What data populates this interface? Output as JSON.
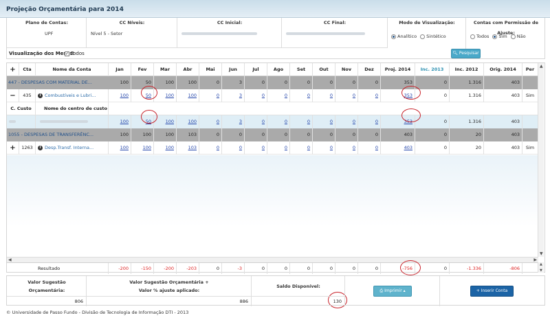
{
  "window": {
    "title": "Projeção Orçamentária para 2014"
  },
  "filters": {
    "plano_label": "Plano de Contas:",
    "plano_value": "UPF",
    "cc_niveis_label": "CC Níveis:",
    "cc_niveis_value": "Nível 5 - Setor",
    "cc_inicial_label": "CC Inicial:",
    "cc_final_label": "CC Final:",
    "modo_label": "Modo de Visualização:",
    "modo_opt1": "Analítico",
    "modo_opt2": "Sintético",
    "contas_label": "Contas com Permissão de Ajuste:",
    "contas_opt1": "Todos",
    "contas_opt2": "Sim",
    "contas_opt3": "Não",
    "meses_label": "Visualização dos Meses:",
    "meses_check": "✓",
    "meses_opt": "Todos",
    "pesquisar_label": "Pesquisar"
  },
  "table": {
    "headers": {
      "plus": "+",
      "cta": "Cta",
      "nome": "Nome da Conta",
      "jan": "Jan",
      "fev": "Fev",
      "mar": "Mar",
      "abr": "Abr",
      "mai": "Mai",
      "jun": "Jun",
      "jul": "Jul",
      "ago": "Ago",
      "set": "Set",
      "out": "Out",
      "nov": "Nov",
      "dez": "Dez",
      "proj": "Proj. 2014",
      "inc2013": "Inc. 2013",
      "inc2012": "Inc. 2012",
      "orig": "Orig. 2014",
      "per": "Per"
    },
    "group1": {
      "label": "447 - DESPESAS COM MATERIAL DE...",
      "vals": [
        "100",
        "50",
        "100",
        "100",
        "0",
        "3",
        "0",
        "0",
        "0",
        "0",
        "0",
        "0",
        "353",
        "0",
        "1.316",
        "403"
      ]
    },
    "row1": {
      "toggle": "−",
      "cta": "435",
      "info": "i",
      "nome": "Combustíveis e Lubri...",
      "vals": [
        "100",
        "50",
        "100",
        "100",
        "0",
        "3",
        "0",
        "0",
        "0",
        "0",
        "0",
        "0",
        "353",
        "0",
        "1.316",
        "403"
      ],
      "per": "Sim"
    },
    "sub_headers": {
      "ccusto": "C. Custo",
      "nome_cc": "Nome do centro de custo"
    },
    "sub_row": {
      "vals": [
        "100",
        "50",
        "100",
        "100",
        "0",
        "3",
        "0",
        "0",
        "0",
        "0",
        "0",
        "0",
        "353",
        "0",
        "1.316",
        "403"
      ]
    },
    "group2": {
      "label": "1055 - DESPESAS DE TRANSFERÊNC...",
      "vals": [
        "100",
        "100",
        "100",
        "103",
        "0",
        "0",
        "0",
        "0",
        "0",
        "0",
        "0",
        "0",
        "403",
        "0",
        "20",
        "403"
      ]
    },
    "row2": {
      "toggle": "+",
      "cta": "1263",
      "info": "i",
      "nome": "Desp.Transf. Interna...",
      "vals": [
        "100",
        "100",
        "100",
        "103",
        "0",
        "0",
        "0",
        "0",
        "0",
        "0",
        "0",
        "0",
        "403",
        "0",
        "20",
        "403"
      ],
      "per": "Sim"
    },
    "result": {
      "label": "Resultado",
      "vals": [
        "-200",
        "-150",
        "-200",
        "-203",
        "0",
        "-3",
        "0",
        "0",
        "0",
        "0",
        "0",
        "0",
        "-756",
        "0",
        "-1.336",
        "-806"
      ]
    }
  },
  "summary": {
    "valor_sugestao_l1": "Valor Sugestão",
    "valor_sugestao_l2": "Orçamentária:",
    "valor_sugestao": "806",
    "valor_ajuste_l1": "Valor Sugestão Orçamentária +",
    "valor_ajuste_l2": "Valor % ajuste aplicado:",
    "valor_ajuste": "886",
    "saldo_label": "Saldo Disponível:",
    "saldo": "130",
    "imprimir_label": "Imprimir",
    "inserir_label": "Inserir Conta"
  },
  "footer": {
    "text": "© Universidade de Passo Fundo - Divisão de Tecnologia de Informação DTI - 2013"
  },
  "colors": {
    "accent": "#4aa9c9",
    "group_row": "#aaaaaa",
    "highlight_row": "#dfeef6",
    "annotation_circle": "#c8222a",
    "insert_button": "#1c64a6"
  }
}
